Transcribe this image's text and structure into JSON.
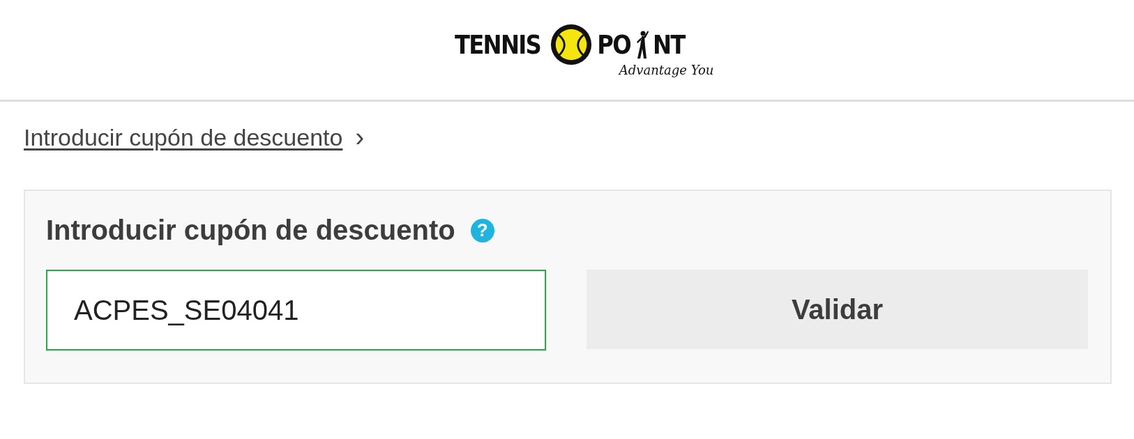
{
  "logo": {
    "word_left": "TENNIS",
    "word_right_start": "PO",
    "word_right_end": "NT",
    "tagline": "Advantage You"
  },
  "coupon_link": {
    "label": "Introducir cupón de descuento",
    "chevron": "›"
  },
  "coupon_panel": {
    "title": "Introducir cupón de descuento",
    "help": "?",
    "field": {
      "value": "ACPES_SE04041",
      "valid": true
    },
    "button": "Validar"
  }
}
